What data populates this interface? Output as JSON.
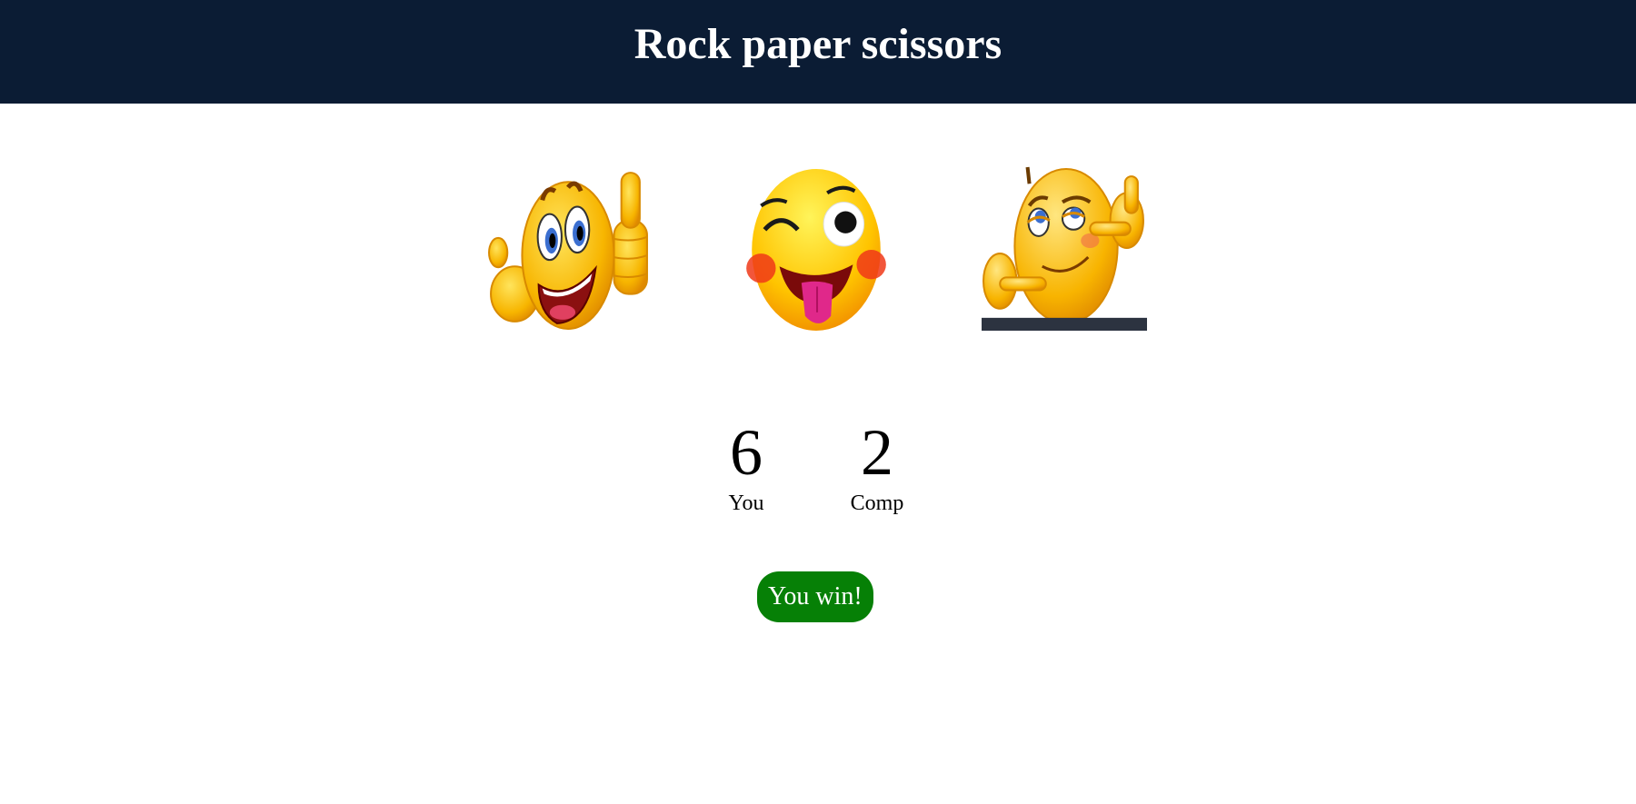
{
  "header": {
    "title": "Rock paper scissors",
    "background": "#0b1c34"
  },
  "choices": [
    {
      "id": "rock",
      "icon": "thumbs-up-emoji-icon"
    },
    {
      "id": "paper",
      "icon": "winking-tongue-emoji-icon"
    },
    {
      "id": "scissors",
      "icon": "pointing-smirk-emoji-icon"
    }
  ],
  "scores": {
    "user": {
      "value": "6",
      "label": "You"
    },
    "comp": {
      "value": "2",
      "label": "Comp"
    }
  },
  "message": {
    "text": "You win!",
    "background": "#068006"
  }
}
